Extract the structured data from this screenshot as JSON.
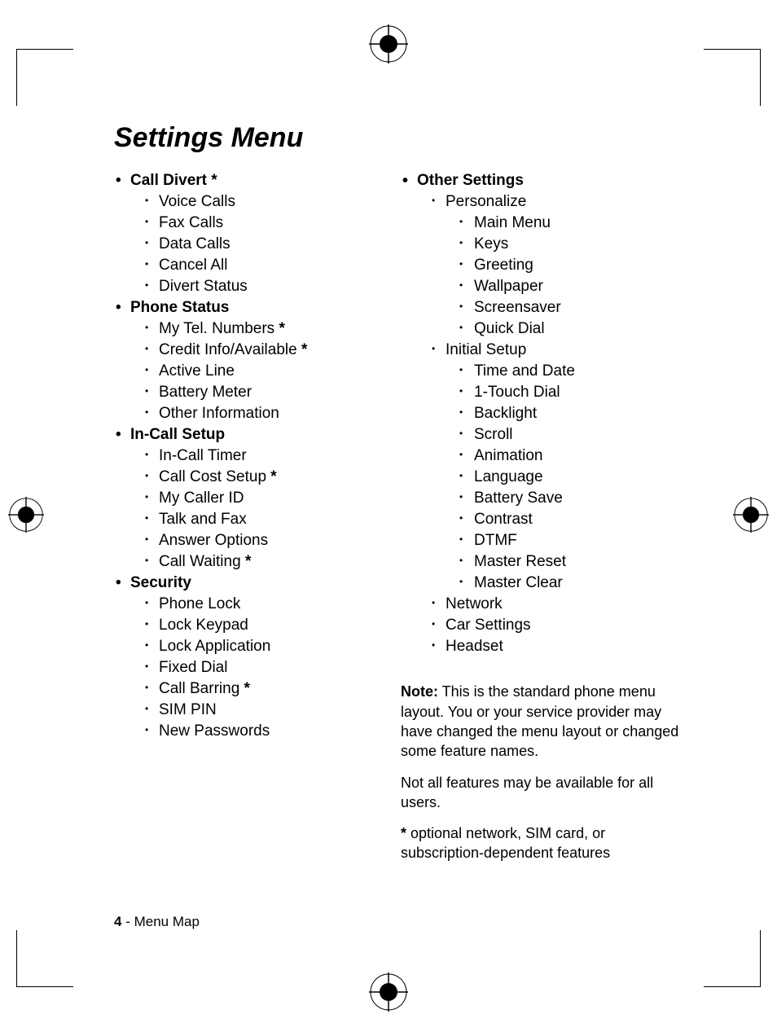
{
  "title": "Settings Menu",
  "left": {
    "s1": {
      "h": "Call Divert *",
      "items": [
        "Voice Calls",
        "Fax Calls",
        "Data Calls",
        "Cancel All",
        "Divert Status"
      ]
    },
    "s2": {
      "h": "Phone Status",
      "items": [
        "My Tel. Numbers *",
        "Credit Info/Available *",
        "Active Line",
        "Battery Meter",
        "Other Information"
      ]
    },
    "s3": {
      "h": "In-Call Setup",
      "items": [
        "In-Call Timer",
        "Call Cost Setup *",
        "My Caller ID",
        "Talk and Fax",
        "Answer Options",
        "Call Waiting *"
      ]
    },
    "s4": {
      "h": "Security",
      "items": [
        "Phone Lock",
        "Lock Keypad",
        "Lock Application",
        "Fixed Dial",
        "Call Barring *",
        "SIM PIN",
        "New Passwords"
      ]
    }
  },
  "right": {
    "h": "Other Settings",
    "personalize": {
      "h": "Personalize",
      "items": [
        "Main Menu",
        "Keys",
        "Greeting",
        "Wallpaper",
        "Screensaver",
        "Quick Dial"
      ]
    },
    "initial": {
      "h": "Initial Setup",
      "items": [
        "Time and Date",
        "1-Touch Dial",
        "Backlight",
        "Scroll",
        "Animation",
        "Language",
        "Battery Save",
        "Contrast",
        "DTMF",
        "Master Reset",
        "Master Clear"
      ]
    },
    "rest": [
      "Network",
      "Car Settings",
      "Headset"
    ]
  },
  "notes": {
    "p1_label": "Note:",
    "p1": " This is the standard phone menu layout. You or your service provider may have changed the menu layout or changed some feature names.",
    "p2": "Not all features may be available for all users.",
    "p3_label": "*",
    "p3": " optional network, SIM card, or subscription-dependent features"
  },
  "footer": {
    "page": "4",
    "sep": " - ",
    "section": "Menu Map"
  }
}
